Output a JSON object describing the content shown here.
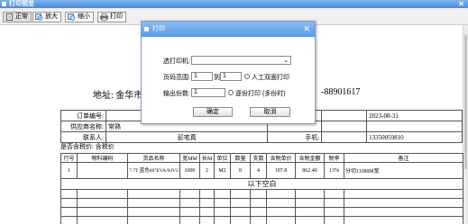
{
  "window": {
    "title": "打印预览",
    "close_glyph": "✕"
  },
  "toolbar": {
    "buttons": [
      {
        "label": "正常",
        "icon": "page-icon"
      },
      {
        "label": "放大",
        "icon": "zoom-in-icon"
      },
      {
        "label": "缩小",
        "icon": "zoom-out-icon"
      },
      {
        "label": "打印",
        "icon": "printer-icon"
      }
    ]
  },
  "document": {
    "address": "地址: 金华市",
    "phone": "-88901617",
    "info": {
      "order_no_label": "订单编号:",
      "order_no": "",
      "date": "2023-08-31",
      "supplier_label": "供应商名称:",
      "supplier": "常熟",
      "contact_label": "联系人:",
      "contact": "彭宅真",
      "mobile_label": "手机:",
      "mobile": "13350059810"
    },
    "remark": "是否含税价: 含税价",
    "items_headers": [
      "行号",
      "物料编码",
      "货品名称",
      "宽MM",
      "长M",
      "单位",
      "数量",
      "支数",
      "含税单价",
      "含税金额",
      "税率",
      "备注"
    ],
    "items": [
      {
        "line": "1",
        "code": "",
        "name": "7.7T 蓝色60°EVA/94V2",
        "width": "1000",
        "length": "2",
        "unit": "M2",
        "qty": "8",
        "pieces": "4",
        "price": "107.8",
        "amount": "862.40",
        "tax": "13%",
        "note": "分切110MM宽"
      }
    ],
    "empty_note": "以下空白"
  },
  "dialog": {
    "title": "打印",
    "close_glyph": "✕",
    "printer_label": "选打印机:",
    "printer_value": "",
    "page_range_label": "页码范围:",
    "page_from": "1",
    "page_to_label": "到",
    "page_to": "1",
    "duplex_label": "人工双面打印",
    "copies_label": "输出份数:",
    "copies": "1",
    "collate_label": "逐份打印 (多份时)",
    "ok_label": "确定",
    "cancel_label": "取消"
  },
  "colors": {
    "titlebar": "#4a8ad9",
    "dialog_title": "#5b98df",
    "toolbar_bg": "#f0f0f0"
  }
}
